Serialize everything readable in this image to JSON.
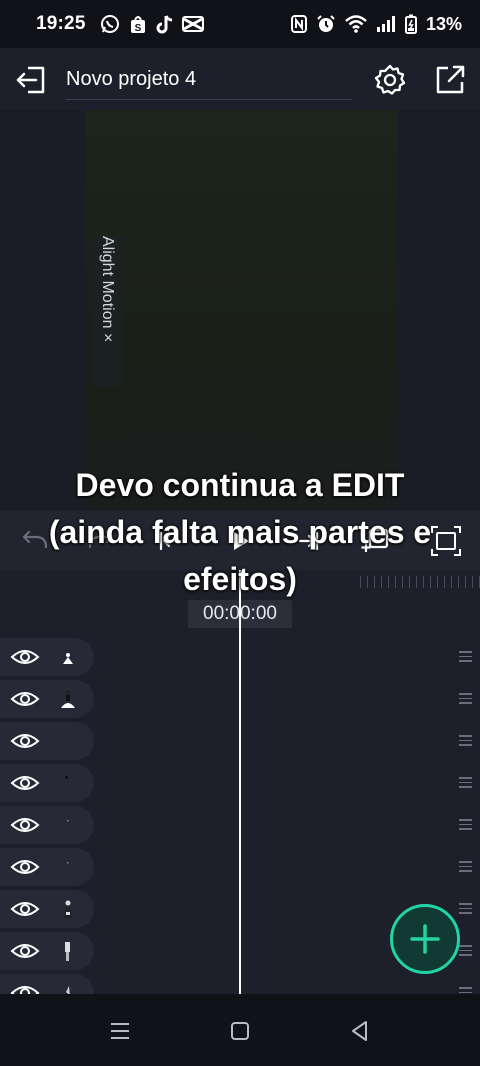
{
  "status_bar": {
    "time": "19:25",
    "app_icons": [
      "whatsapp-icon",
      "shopping-bag-icon",
      "tiktok-icon",
      "capcut-icon"
    ],
    "system_icons": [
      "nfc-icon",
      "alarm-icon",
      "wifi-icon",
      "signal-icon",
      "battery-icon"
    ],
    "battery_percent": "13%"
  },
  "top_bar": {
    "project_title": "Novo projeto 4"
  },
  "preview": {
    "watermark_text": "Alight Motion ×"
  },
  "timeline": {
    "timecode": "00:00:00",
    "layers": [
      {
        "visible": true,
        "thumb": "dancer-white"
      },
      {
        "visible": true,
        "thumb": "dancer-dress"
      },
      {
        "visible": true,
        "thumb": "empty"
      },
      {
        "visible": true,
        "thumb": "dot"
      },
      {
        "visible": true,
        "thumb": "tiny-dot"
      },
      {
        "visible": true,
        "thumb": "tiny-dot"
      },
      {
        "visible": true,
        "thumb": "figure-dark"
      },
      {
        "visible": true,
        "thumb": "figure-standing"
      },
      {
        "visible": true,
        "thumb": "figure-partial"
      }
    ]
  },
  "overlay_caption": "Devo continua a EDIT (ainda falta mais partes e efeitos)",
  "colors": {
    "background": "#1d1f2a",
    "accent": "#22d3a6",
    "playhead": "#ffffff"
  }
}
